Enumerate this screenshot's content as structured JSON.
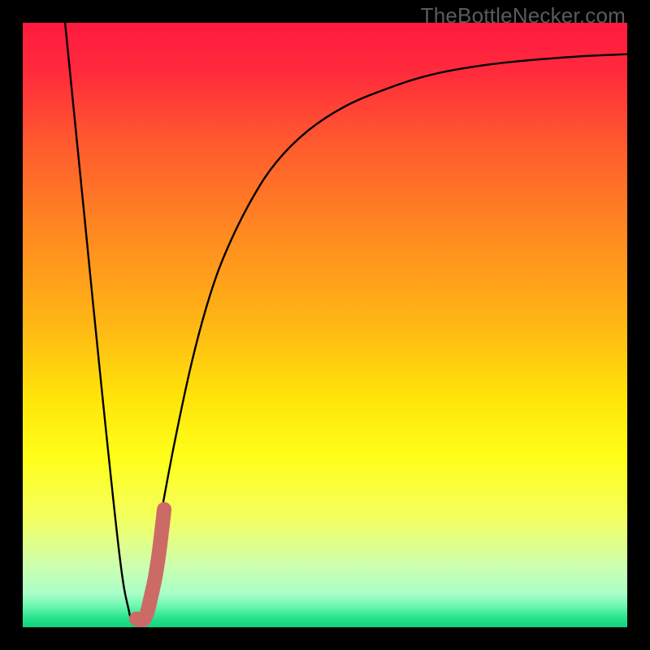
{
  "watermark": "TheBottleNecker.com",
  "colors": {
    "frame": "#000000",
    "curve": "#000000",
    "marker": "#cc6b66"
  },
  "chart_data": {
    "type": "line",
    "title": "",
    "xlabel": "",
    "ylabel": "",
    "xlim": [
      0,
      100
    ],
    "ylim": [
      0,
      100
    ],
    "gradient_stops": [
      {
        "offset": 0.0,
        "color": "#ff1a3f"
      },
      {
        "offset": 0.08,
        "color": "#ff2a3c"
      },
      {
        "offset": 0.2,
        "color": "#ff5a2e"
      },
      {
        "offset": 0.35,
        "color": "#ff8a20"
      },
      {
        "offset": 0.5,
        "color": "#ffb715"
      },
      {
        "offset": 0.62,
        "color": "#ffe40a"
      },
      {
        "offset": 0.72,
        "color": "#ffff1a"
      },
      {
        "offset": 0.82,
        "color": "#f3ff60"
      },
      {
        "offset": 0.9,
        "color": "#ccffb0"
      },
      {
        "offset": 0.945,
        "color": "#a8ffc8"
      },
      {
        "offset": 0.965,
        "color": "#6cf7b0"
      },
      {
        "offset": 0.985,
        "color": "#28e28d"
      },
      {
        "offset": 1.0,
        "color": "#0fd37c"
      }
    ],
    "series": [
      {
        "name": "bottleneck-curve",
        "x": [
          7,
          10,
          13,
          16,
          17.5,
          18.5,
          20,
          22,
          25,
          28,
          31,
          34,
          38,
          42,
          47,
          53,
          60,
          68,
          78,
          90,
          100
        ],
        "y": [
          100,
          70,
          40,
          12,
          3,
          0.5,
          4,
          14,
          30,
          44,
          55,
          63,
          71,
          77,
          82,
          86,
          89,
          91.5,
          93.2,
          94.3,
          94.8
        ]
      }
    ],
    "marker": {
      "name": "selected-range",
      "x": [
        18.8,
        19.3,
        20.0,
        20.6,
        21.2,
        21.9,
        22.5,
        23.0,
        23.4
      ],
      "y": [
        1.4,
        1.2,
        1.3,
        2.5,
        5.0,
        8.2,
        12.0,
        16.0,
        19.5
      ]
    }
  }
}
